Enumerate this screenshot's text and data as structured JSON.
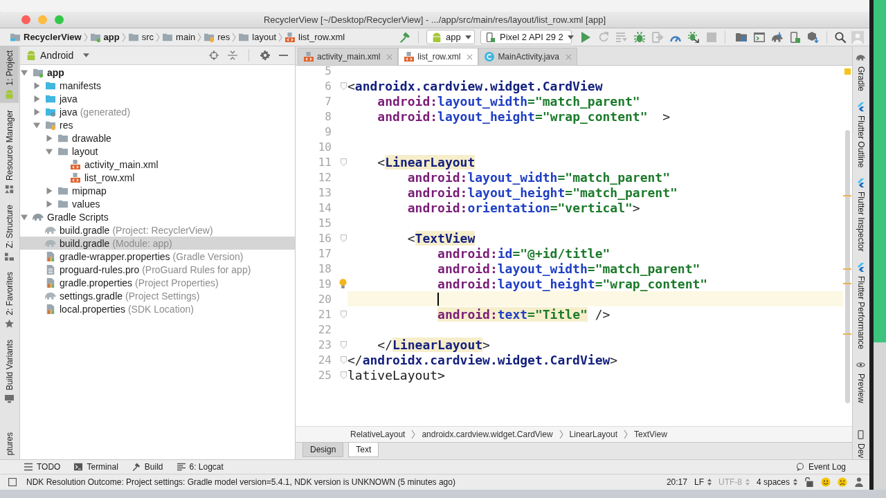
{
  "window": {
    "title": "RecyclerView [~/Desktop/RecyclerView] - .../app/src/main/res/layout/list_row.xml [app]"
  },
  "navigation_bar": {
    "path": [
      {
        "label": "RecyclerView",
        "kind": "project"
      },
      {
        "label": "app",
        "kind": "module"
      },
      {
        "label": "src",
        "kind": "folder"
      },
      {
        "label": "main",
        "kind": "folder"
      },
      {
        "label": "res",
        "kind": "res-folder"
      },
      {
        "label": "layout",
        "kind": "folder"
      },
      {
        "label": "list_row.xml",
        "kind": "layout-file"
      }
    ],
    "run_configuration": "app",
    "device": "Pixel 2 API 29 2",
    "run_buttons": [
      {
        "kind": "run",
        "disabled": false
      },
      {
        "kind": "rerun",
        "disabled": true
      },
      {
        "kind": "apply-changes",
        "disabled": true
      },
      {
        "kind": "debug",
        "disabled": false
      },
      {
        "kind": "attach",
        "disabled": true
      },
      {
        "kind": "profile",
        "disabled": false
      },
      {
        "kind": "attach-debugger",
        "disabled": false
      },
      {
        "kind": "stop",
        "disabled": true
      }
    ]
  },
  "left_tool_strip": [
    {
      "label": "1: Project",
      "kind": "project",
      "selected": true
    },
    {
      "label": "Resource Manager",
      "kind": "resources",
      "selected": false
    },
    {
      "label": "Z: Structure",
      "kind": "structure",
      "selected": false
    },
    {
      "label": "2: Favorites",
      "kind": "favorites",
      "selected": false
    },
    {
      "label": "Build Variants",
      "kind": "variants",
      "selected": false
    },
    {
      "label": "ptures",
      "kind": "captures",
      "selected": false
    }
  ],
  "project_panel": {
    "view": "Android",
    "tree": [
      {
        "label": "app",
        "kind": "module",
        "expanded": true,
        "selected": false,
        "children": [
          {
            "label": "manifests",
            "kind": "source-folder",
            "expanded": false,
            "selected": false
          },
          {
            "label": "java",
            "kind": "source-folder",
            "expanded": false,
            "selected": false
          },
          {
            "label": "java",
            "note": "(generated)",
            "kind": "generated-folder",
            "expanded": false,
            "selected": false
          },
          {
            "label": "res",
            "kind": "res-folder",
            "expanded": true,
            "selected": false,
            "children": [
              {
                "label": "drawable",
                "kind": "folder",
                "expanded": false,
                "selected": false
              },
              {
                "label": "layout",
                "kind": "folder",
                "expanded": true,
                "selected": false,
                "children": [
                  {
                    "label": "activity_main.xml",
                    "kind": "layout-file",
                    "selected": false
                  },
                  {
                    "label": "list_row.xml",
                    "kind": "layout-file",
                    "selected": false
                  }
                ]
              },
              {
                "label": "mipmap",
                "kind": "folder",
                "expanded": false,
                "selected": false
              },
              {
                "label": "values",
                "kind": "folder",
                "expanded": false,
                "selected": false
              }
            ]
          }
        ]
      },
      {
        "label": "Gradle Scripts",
        "kind": "gradle-group",
        "expanded": true,
        "selected": false,
        "children": [
          {
            "label": "build.gradle",
            "note": "(Project: RecyclerView)",
            "kind": "gradle-file",
            "selected": false
          },
          {
            "label": "build.gradle",
            "note": "(Module: app)",
            "kind": "gradle-file",
            "selected": true
          },
          {
            "label": "gradle-wrapper.properties",
            "note": "(Gradle Version)",
            "kind": "properties-file",
            "selected": false
          },
          {
            "label": "proguard-rules.pro",
            "note": "(ProGuard Rules for app)",
            "kind": "text-file",
            "selected": false
          },
          {
            "label": "gradle.properties",
            "note": "(Project Properties)",
            "kind": "properties-file",
            "selected": false
          },
          {
            "label": "settings.gradle",
            "note": "(Project Settings)",
            "kind": "gradle-file",
            "selected": false
          },
          {
            "label": "local.properties",
            "note": "(SDK Location)",
            "kind": "properties-file",
            "selected": false
          }
        ]
      }
    ]
  },
  "editor": {
    "tabs": [
      {
        "label": "activity_main.xml",
        "kind": "layout-file",
        "selected": false
      },
      {
        "label": "list_row.xml",
        "kind": "layout-file",
        "selected": true
      },
      {
        "label": "MainActivity.java",
        "kind": "java-class",
        "selected": false
      }
    ],
    "lines": [
      {
        "number": "5",
        "fold": false,
        "bulb": false,
        "current": false
      },
      {
        "number": "6",
        "fold": true,
        "bulb": false,
        "current": false,
        "tokens": [
          {
            "text": "<",
            "kind": "punct",
            "highlight": false
          },
          {
            "text": "androidx.cardview.widget.CardView",
            "kind": "tag",
            "highlight": false
          }
        ]
      },
      {
        "number": "7",
        "fold": false,
        "bulb": false,
        "current": false,
        "tokens": [
          {
            "text": "    android:",
            "kind": "ns",
            "highlight": false
          },
          {
            "text": "layout_width",
            "kind": "attr",
            "highlight": false
          },
          {
            "text": "=\"match_parent\"",
            "kind": "value",
            "highlight": false
          }
        ]
      },
      {
        "number": "8",
        "fold": false,
        "bulb": false,
        "current": false,
        "tokens": [
          {
            "text": "    android:",
            "kind": "ns",
            "highlight": false
          },
          {
            "text": "layout_height",
            "kind": "attr",
            "highlight": false
          },
          {
            "text": "=\"wrap_content\"",
            "kind": "value",
            "highlight": false
          },
          {
            "text": "  >",
            "kind": "punct",
            "highlight": false
          }
        ]
      },
      {
        "number": "9",
        "fold": false,
        "bulb": false,
        "current": false
      },
      {
        "number": "10",
        "fold": false,
        "bulb": false,
        "current": false
      },
      {
        "number": "11",
        "fold": true,
        "bulb": false,
        "current": false,
        "tokens": [
          {
            "text": "    <",
            "kind": "punct",
            "highlight": false
          },
          {
            "text": "LinearLayout",
            "kind": "tag",
            "highlight": true
          }
        ]
      },
      {
        "number": "12",
        "fold": false,
        "bulb": false,
        "current": false,
        "tokens": [
          {
            "text": "        android:",
            "kind": "ns",
            "highlight": false
          },
          {
            "text": "layout_width",
            "kind": "attr",
            "highlight": false
          },
          {
            "text": "=\"match_parent\"",
            "kind": "value",
            "highlight": false
          }
        ]
      },
      {
        "number": "13",
        "fold": false,
        "bulb": false,
        "current": false,
        "tokens": [
          {
            "text": "        android:",
            "kind": "ns",
            "highlight": false
          },
          {
            "text": "layout_height",
            "kind": "attr",
            "highlight": false
          },
          {
            "text": "=\"match_parent\"",
            "kind": "value",
            "highlight": false
          }
        ]
      },
      {
        "number": "14",
        "fold": false,
        "bulb": false,
        "current": false,
        "tokens": [
          {
            "text": "        android:",
            "kind": "ns",
            "highlight": false
          },
          {
            "text": "orientation",
            "kind": "attr",
            "highlight": false
          },
          {
            "text": "=\"vertical\"",
            "kind": "value",
            "highlight": false
          },
          {
            "text": ">",
            "kind": "punct",
            "highlight": false
          }
        ]
      },
      {
        "number": "15",
        "fold": false,
        "bulb": false,
        "current": false
      },
      {
        "number": "16",
        "fold": true,
        "bulb": false,
        "current": false,
        "tokens": [
          {
            "text": "        <",
            "kind": "punct",
            "highlight": false
          },
          {
            "text": "TextView",
            "kind": "tag",
            "highlight": true
          }
        ]
      },
      {
        "number": "17",
        "fold": false,
        "bulb": false,
        "current": false,
        "tokens": [
          {
            "text": "            android:",
            "kind": "ns",
            "highlight": false
          },
          {
            "text": "id",
            "kind": "attr",
            "highlight": false
          },
          {
            "text": "=\"@+id/title\"",
            "kind": "value",
            "highlight": false
          }
        ]
      },
      {
        "number": "18",
        "fold": false,
        "bulb": false,
        "current": false,
        "tokens": [
          {
            "text": "            android:",
            "kind": "ns",
            "highlight": false
          },
          {
            "text": "layout_width",
            "kind": "attr",
            "highlight": false
          },
          {
            "text": "=\"match_parent\"",
            "kind": "value",
            "highlight": false
          }
        ]
      },
      {
        "number": "19",
        "fold": false,
        "bulb": true,
        "current": false,
        "tokens": [
          {
            "text": "            android:",
            "kind": "ns",
            "highlight": false
          },
          {
            "text": "layout_height",
            "kind": "attr",
            "highlight": false
          },
          {
            "text": "=\"wrap_content\"",
            "kind": "value",
            "highlight": false
          }
        ]
      },
      {
        "number": "20",
        "fold": false,
        "bulb": false,
        "current": true
      },
      {
        "number": "21",
        "fold": true,
        "bulb": false,
        "current": false,
        "tokens": [
          {
            "text": "            android:",
            "kind": "ns",
            "highlight": true
          },
          {
            "text": "text",
            "kind": "attr",
            "highlight": true
          },
          {
            "text": "=\"Title\"",
            "kind": "value",
            "highlight": true
          },
          {
            "text": " />",
            "kind": "punct",
            "highlight": false
          }
        ]
      },
      {
        "number": "22",
        "fold": false,
        "bulb": false,
        "current": false
      },
      {
        "number": "23",
        "fold": true,
        "bulb": false,
        "current": false,
        "tokens": [
          {
            "text": "    </",
            "kind": "punct",
            "highlight": false
          },
          {
            "text": "LinearLayout",
            "kind": "tag",
            "highlight": true
          },
          {
            "text": ">",
            "kind": "punct",
            "highlight": false
          }
        ]
      },
      {
        "number": "24",
        "fold": true,
        "bulb": false,
        "current": false,
        "tokens": [
          {
            "text": "</",
            "kind": "punct",
            "highlight": false
          },
          {
            "text": "androidx.cardview.widget.CardView",
            "kind": "tag",
            "highlight": false
          },
          {
            "text": ">",
            "kind": "punct",
            "highlight": false
          }
        ]
      },
      {
        "number": "25",
        "fold": true,
        "bulb": false,
        "current": false,
        "tokens": [
          {
            "text": "lativeLayout>",
            "kind": "text",
            "highlight": false
          }
        ]
      }
    ],
    "breadcrumb": [
      "RelativeLayout",
      "androidx.cardview.widget.CardView",
      "LinearLayout",
      "TextView"
    ],
    "mode_tabs": [
      {
        "label": "Design",
        "selected": false
      },
      {
        "label": "Text",
        "selected": true
      }
    ]
  },
  "right_tool_strip": [
    {
      "label": "Gradle",
      "kind": "gradle"
    },
    {
      "label": "Flutter Outline",
      "kind": "flutter"
    },
    {
      "label": "Flutter Inspector",
      "kind": "flutter"
    },
    {
      "label": "Flutter Performance",
      "kind": "flutter"
    },
    {
      "label": "Preview",
      "kind": "preview"
    },
    {
      "label": "Dev",
      "kind": "device"
    }
  ],
  "bottom_tools": [
    {
      "label": "TODO",
      "kind": "todo"
    },
    {
      "label": "Terminal",
      "kind": "terminal"
    },
    {
      "label": "Build",
      "kind": "build"
    },
    {
      "label": "6: Logcat",
      "kind": "logcat"
    }
  ],
  "event_log": {
    "label": "Event Log"
  },
  "status_bar": {
    "message": "NDK Resolution Outcome: Project settings: Gradle model version=5.4.1, NDK version is UNKNOWN (5 minutes ago)",
    "items": [
      {
        "text": "20:17",
        "kind": "text",
        "disabled": false
      },
      {
        "text": "LF",
        "kind": "dropdown",
        "disabled": false
      },
      {
        "text": "UTF-8",
        "kind": "dropdown",
        "disabled": true
      },
      {
        "text": "4 spaces",
        "kind": "dropdown",
        "disabled": false
      }
    ]
  }
}
